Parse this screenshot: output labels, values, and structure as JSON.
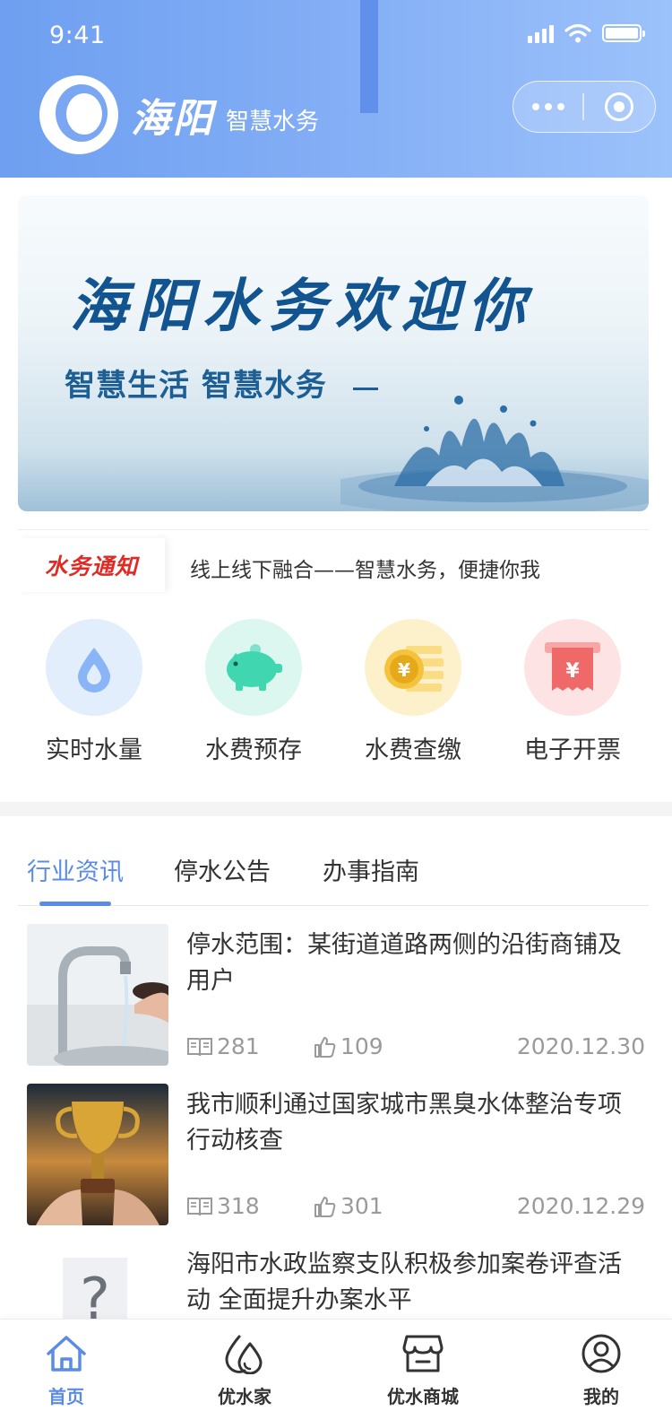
{
  "status_bar": {
    "time": "9:41"
  },
  "header": {
    "logo_name": "海阳",
    "logo_subtitle": "智慧水务"
  },
  "banner": {
    "title": "海阳水务欢迎你",
    "subtitle": "智慧生活  智慧水务"
  },
  "notice": {
    "badge": "水务通知",
    "text": "线上线下融合——智慧水务，便捷你我"
  },
  "services": [
    {
      "label": "实时水量",
      "icon": "water-drop-icon",
      "bg": "#e3eefc",
      "color": "#89b4f5"
    },
    {
      "label": "水费预存",
      "icon": "piggy-bank-icon",
      "bg": "#dcf7f0",
      "color": "#3fd6b0"
    },
    {
      "label": "水费查缴",
      "icon": "coin-icon",
      "bg": "#fdf1cc",
      "color": "#f5c33b"
    },
    {
      "label": "电子开票",
      "icon": "receipt-icon",
      "bg": "#fde3e3",
      "color": "#f06969"
    }
  ],
  "tabs": [
    {
      "label": "行业资讯",
      "active": true
    },
    {
      "label": "停水公告",
      "active": false
    },
    {
      "label": "办事指南",
      "active": false
    }
  ],
  "news": [
    {
      "title": "停水范围：某街道道路两侧的沿街商铺及用户",
      "reads": "281",
      "likes": "109",
      "date": "2020.12.30",
      "thumb": "faucet-photo"
    },
    {
      "title": "我市顺利通过国家城市黑臭水体整治专项行动核查",
      "reads": "318",
      "likes": "301",
      "date": "2020.12.29",
      "thumb": "trophy-photo"
    },
    {
      "title": "海阳市水政监察支队积极参加案卷评查活动 全面提升办案水平",
      "reads": "",
      "likes": "",
      "date": "",
      "thumb": "placeholder-image"
    }
  ],
  "tabbar": [
    {
      "label": "首页",
      "icon": "home-icon",
      "active": true
    },
    {
      "label": "优水家",
      "icon": "water-drops-icon",
      "active": false
    },
    {
      "label": "优水商城",
      "icon": "shop-icon",
      "active": false
    },
    {
      "label": "我的",
      "icon": "user-icon",
      "active": false
    }
  ],
  "colors": {
    "primary": "#5b8be8",
    "notice_red": "#e02a24",
    "meta_gray": "#9a9a9a"
  }
}
